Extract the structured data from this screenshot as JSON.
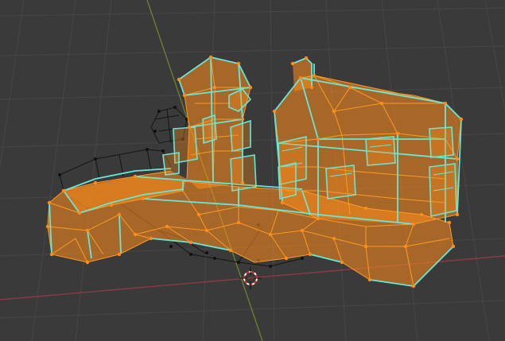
{
  "viewport": {
    "background": "#3a3a3a",
    "grid_color": "#474747",
    "axis_x_color": "#8a3a44",
    "axis_y_color": "#6c8a2c"
  },
  "mesh": {
    "face_color": "#ff8c1a",
    "edge_selected_color": "#ff9f2a",
    "seam_color": "#66e0d0",
    "vertex_color": "#ff8c1a",
    "unselected_color": "#111111"
  },
  "icons": {
    "cursor": "3d-cursor-icon"
  }
}
